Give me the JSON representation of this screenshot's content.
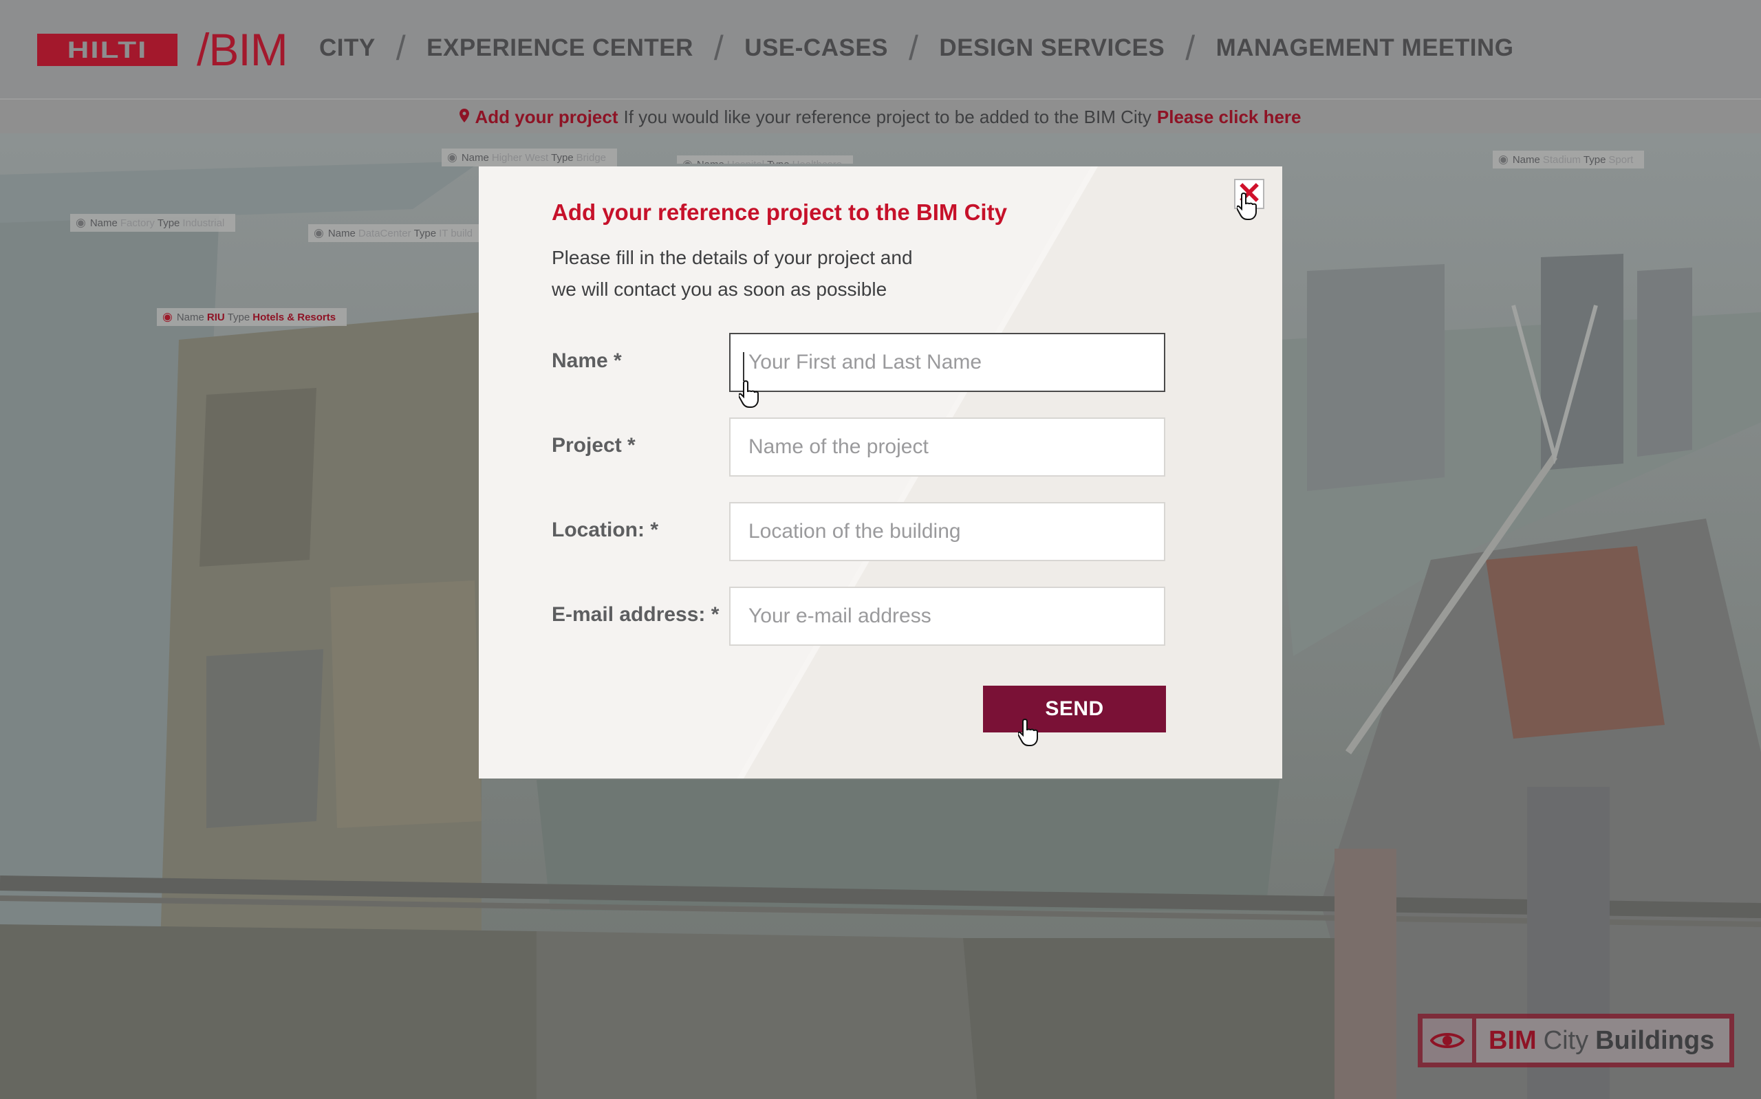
{
  "header": {
    "logo_text": "HILTI",
    "bim_label": "/BIM",
    "nav": [
      {
        "label": "CITY"
      },
      {
        "label": "EXPERIENCE CENTER"
      },
      {
        "label": "USE-CASES"
      },
      {
        "label": "DESIGN SERVICES"
      },
      {
        "label": "MANAGEMENT MEETING"
      }
    ],
    "separator": "/"
  },
  "infobar": {
    "pin_icon": "map-pin-icon",
    "lead": "Add your project",
    "text": "If you would like your reference project to be added to the BIM City",
    "link": "Please click here"
  },
  "map_labels": [
    {
      "name_label": "Name",
      "name": "Higher West",
      "type_label": "Type",
      "type": "Bridge"
    },
    {
      "name_label": "Name",
      "name": "Hospital",
      "type_label": "Type",
      "type": "Healthcare"
    },
    {
      "name_label": "Name",
      "name": "Stadium",
      "type_label": "Type",
      "type": "Sport"
    },
    {
      "name_label": "Name",
      "name": "Factory",
      "type_label": "Type",
      "type": "Industrial"
    },
    {
      "name_label": "Name",
      "name": "DataCenter",
      "type_label": "Type",
      "type": "IT build"
    },
    {
      "name_label": "Name",
      "name": "RIU",
      "type_label": "Type",
      "type": "Hotels & Resorts"
    }
  ],
  "modal": {
    "title": "Add your reference project to the BIM City",
    "desc_line1": "Please fill in the details of your project and",
    "desc_line2": "we will contact you as soon as possible",
    "close_icon": "close-icon",
    "fields": [
      {
        "label": "Name *",
        "placeholder": "Your First and Last Name",
        "value": ""
      },
      {
        "label": "Project *",
        "placeholder": "Name of the project",
        "value": ""
      },
      {
        "label": "Location: *",
        "placeholder": "Location of the building",
        "value": ""
      },
      {
        "label": "E-mail address: *",
        "placeholder": "Your e-mail address",
        "value": ""
      }
    ],
    "send_label": "SEND"
  },
  "badge": {
    "icon": "eye-icon",
    "part1": "BIM",
    "part2": "City",
    "part3": "Buildings"
  },
  "colors": {
    "brand_red": "#a3182c",
    "title_red": "#c6112a",
    "send_button": "#7a1136"
  }
}
